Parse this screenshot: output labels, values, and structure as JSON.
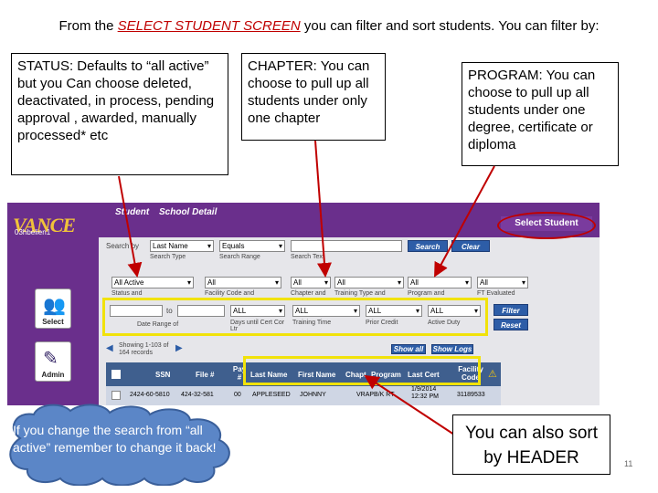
{
  "title": {
    "pre": "From the ",
    "highlight": "SELECT STUDENT SCREEN",
    "post": " you can filter and sort students.  You can filter by:"
  },
  "callouts": {
    "status": "STATUS:  Defaults to “all active” but you Can choose deleted, deactivated, in process, pending approval , awarded, manually processed* etc",
    "chapter": "CHAPTER: You can choose to pull up all students under only one chapter",
    "program": "PROGRAM: You can choose to pull up all students under one degree, certificate or diploma",
    "sort": "You can also sort by HEADER",
    "cloud": "If you change the search from “all active” remember to change it back!"
  },
  "page_number": "11",
  "app": {
    "logo_main": "VA",
    "logo_sub": "NCE",
    "user_id": "03hbelien1\n2-1-1999-30",
    "tabs": [
      "Student",
      "School Detail"
    ],
    "select_student": "Select Student",
    "search_by_label": "Search by",
    "search_type": "Last Name",
    "search_range": "Equals",
    "search_text": "",
    "search_button": "Search",
    "clear_button": "Clear",
    "sub_labels_1": [
      "Search Type",
      "Search Range",
      "Search Text"
    ],
    "filters_1": [
      "All Active",
      "All",
      "All",
      "All",
      "All",
      "All"
    ],
    "filter_labels_1": [
      "Status and",
      "Facility Code and",
      "Chapter and",
      "Training Type and",
      "Program and",
      "FT Evaluated"
    ],
    "date_to": "to",
    "filters_2": [
      "ALL",
      "ALL",
      "ALL",
      "ALL"
    ],
    "filter_labels_2": [
      "Date Range of",
      "Days until Cert Cor Ltr",
      "Training Time",
      "Prior Credit",
      "Active Duty"
    ],
    "filter_button": "Filter",
    "reset_button": "Reset",
    "showing": "Showing 1-103 of 164 records",
    "show_all": "Show all",
    "show_logs": "Show Logs",
    "sidebar": [
      "Select",
      "Admin"
    ],
    "headers": [
      "SSN",
      "File #",
      "Pay #",
      "Last Name",
      "First Name",
      "Chapt",
      "Program",
      "Last Cert",
      "Facility Code"
    ],
    "row": [
      "2424-60-5810",
      "424-32-581",
      "00",
      "APPLESEED",
      "JOHNNY",
      "",
      "VRAPB/K RT",
      "1/9/2014 12:32 PM",
      "31189533"
    ]
  }
}
